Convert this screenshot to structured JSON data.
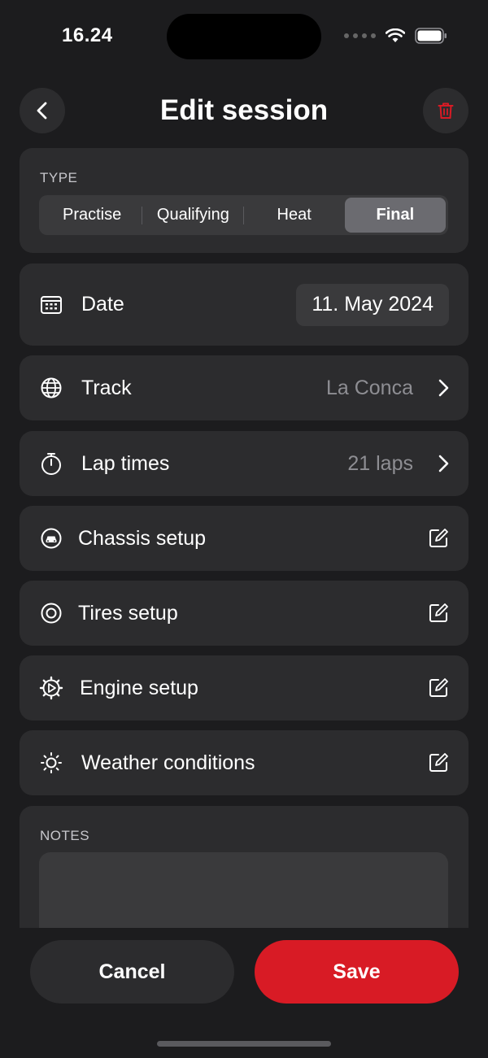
{
  "status_bar": {
    "time": "16.24"
  },
  "header": {
    "title": "Edit session"
  },
  "type_section": {
    "label": "TYPE",
    "options": [
      "Practise",
      "Qualifying",
      "Heat",
      "Final"
    ],
    "selected": "Final"
  },
  "date_row": {
    "label": "Date",
    "value": "11. May 2024"
  },
  "track_row": {
    "label": "Track",
    "value": "La Conca"
  },
  "lap_times_row": {
    "label": "Lap times",
    "value": "21 laps"
  },
  "chassis_row": {
    "label": "Chassis setup"
  },
  "tires_row": {
    "label": "Tires setup"
  },
  "engine_row": {
    "label": "Engine setup"
  },
  "weather_row": {
    "label": "Weather conditions"
  },
  "notes": {
    "label": "NOTES",
    "value": ""
  },
  "actions": {
    "cancel_label": "Cancel",
    "save_label": "Save"
  },
  "colors": {
    "accent": "#d81b25",
    "background": "#1c1c1e",
    "card": "#2c2c2e"
  }
}
